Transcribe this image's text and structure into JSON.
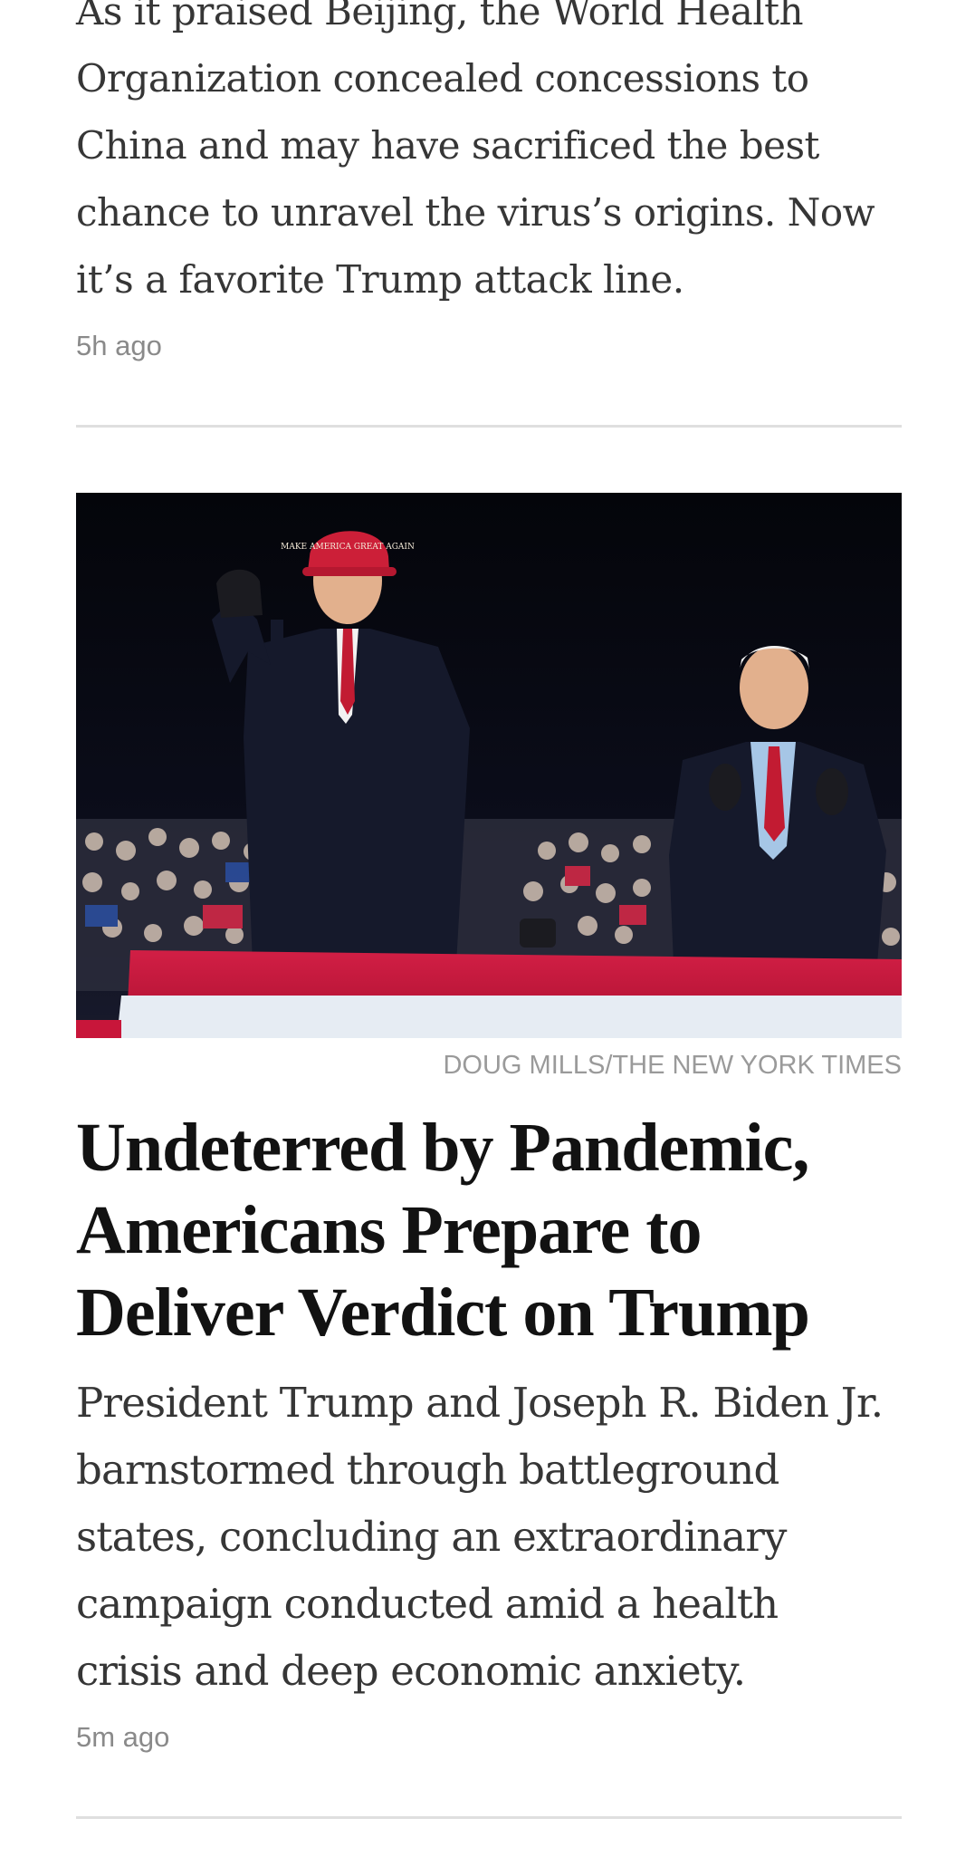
{
  "articles": [
    {
      "summary": "As it praised Beijing, the World Health Organization concealed concessions to China and may have sacrificed the best chance to unravel the virus’s origins. Now it’s a favorite Trump attack line.",
      "timestamp": "5h ago"
    },
    {
      "image_alt": "Campaign rally photo",
      "hat_text": "MAKE AMERICA GREAT AGAIN",
      "photo_credit": "DOUG MILLS/THE NEW YORK TIMES",
      "headline": "Undeterred by Pandemic, Americans Prepare to Deliver Verdict on Trump",
      "summary": "President Trump and Joseph R. Biden Jr. barnstormed through battleground states, concluding an extraordinary campaign conducted amid a health crisis and deep economic anxiety.",
      "timestamp": "5m ago"
    }
  ],
  "colors": {
    "headline": "#121212",
    "body_text": "#363636",
    "meta_text": "#8a8a8a",
    "divider": "#dfdfdf",
    "stage_red": "#c8163a"
  }
}
